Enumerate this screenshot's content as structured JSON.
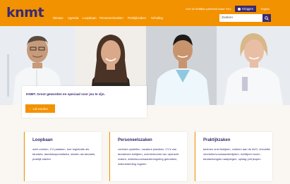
{
  "header": {
    "logo": "knmt",
    "utility": [
      "Over de KNMT",
      "Voor patiënten",
      "Contact",
      "Pers"
    ],
    "login_label": "Inloggen",
    "lang": "English",
    "nav": [
      "Nieuws",
      "Agenda",
      "Loopbaan",
      "Personeelszaken",
      "Praktijkzaken",
      "Scholing"
    ],
    "search_placeholder": "Zoeken"
  },
  "hero": {
    "intro": "KNMT. Groot geworden en speciaal voor jou te zijn.",
    "cta": "Lid worden"
  },
  "cards": [
    {
      "title": "Loopbaan",
      "body": "werk zoeken, CV plaatsen, hoe registratie als tandarts, tandartsspecialisten, starten als tandarts, praktijk starten"
    },
    {
      "title": "Personeelszaken",
      "body": "contract opstellen, vacature plaatsen, CV's van tandartsen bekijken, overeenkomst van opdracht maken, arbeidsvoorwaardenregeling gebruiken, indiensttreding regelen"
    },
    {
      "title": "Praktijkzaken",
      "body": "tarieven snel bekijken, voldoen aan de AVG, checklist vereisten/voorwaardenlijsten, richtlijnen lezen, tandartsengids raadplegen, opslag (ver)kopen"
    }
  ],
  "colors": {
    "accent": "#f39200",
    "brand": "#3a2a70",
    "background": "#faf7f2"
  }
}
